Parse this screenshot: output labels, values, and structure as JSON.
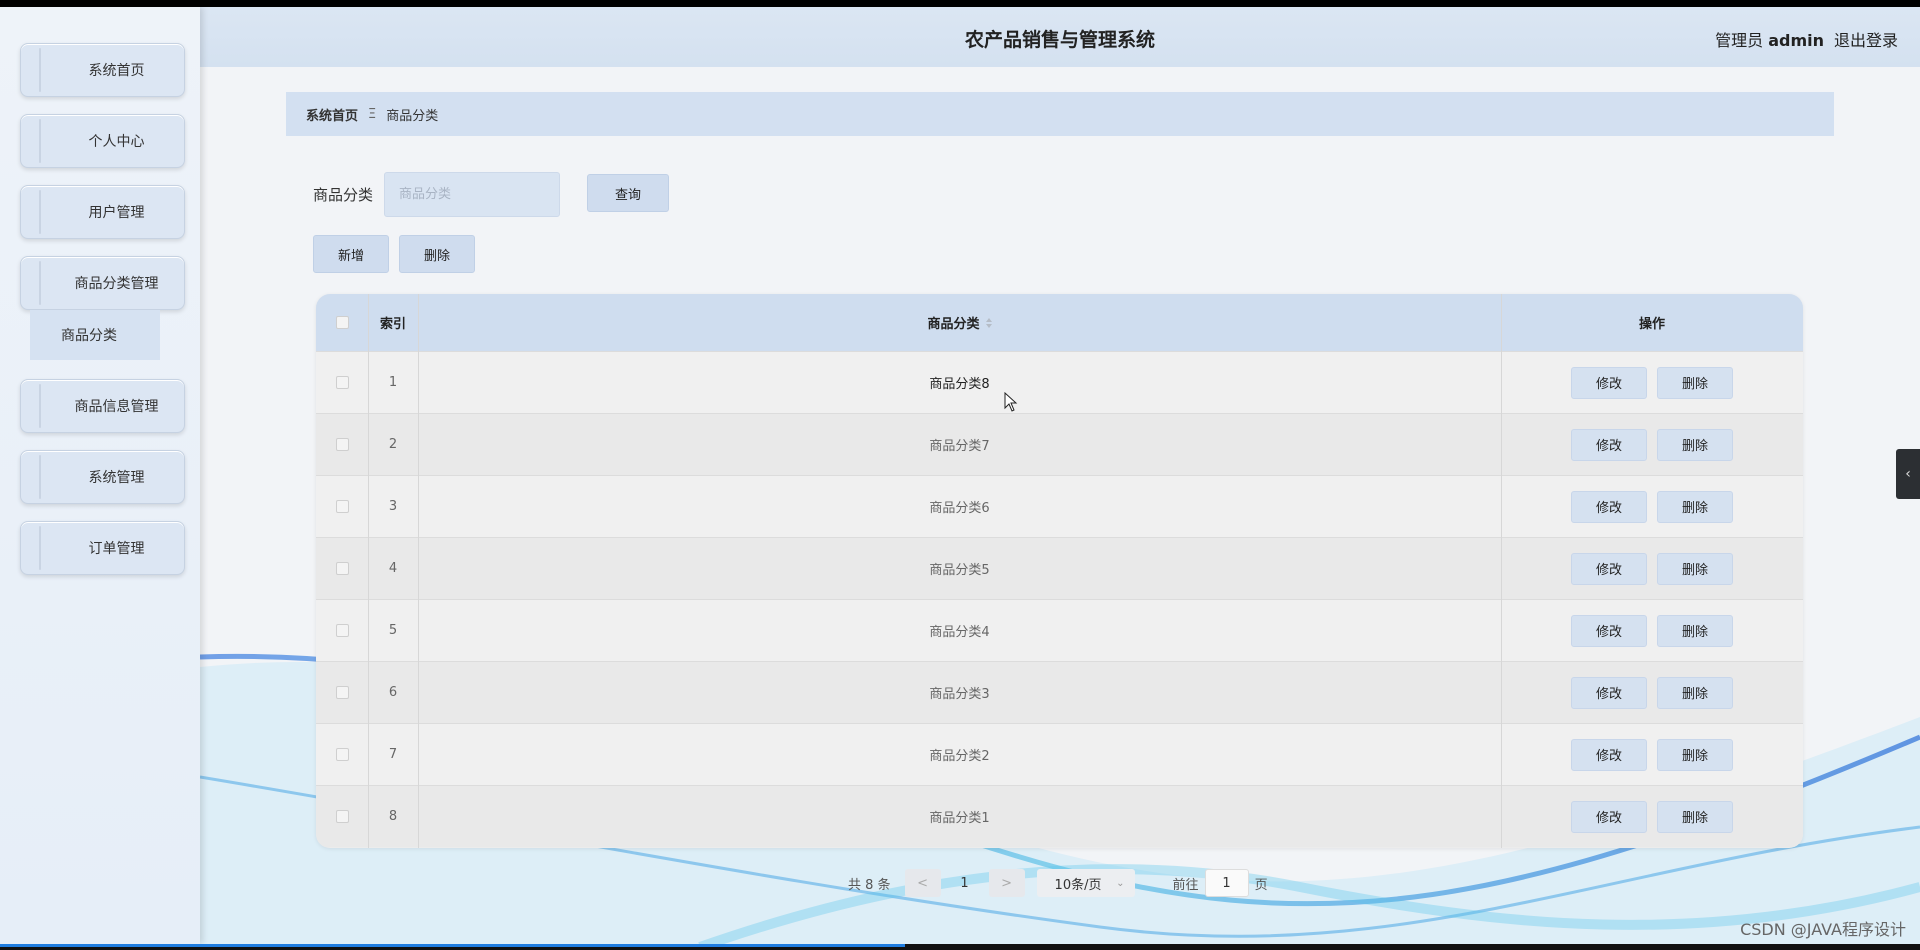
{
  "header": {
    "title": "农产品销售与管理系统",
    "role_label": "管理员",
    "username": "admin",
    "logout_label": "退出登录"
  },
  "sidebar": {
    "items": [
      {
        "label": "系统首页"
      },
      {
        "label": "个人中心"
      },
      {
        "label": "用户管理"
      },
      {
        "label": "商品分类管理"
      },
      {
        "label": "商品信息管理"
      },
      {
        "label": "系统管理"
      },
      {
        "label": "订单管理"
      }
    ],
    "active_submenu": "商品分类"
  },
  "breadcrumb": {
    "home": "系统首页",
    "separator": "Ξ",
    "current": "商品分类"
  },
  "search": {
    "label": "商品分类",
    "placeholder": "商品分类",
    "query_button": "查询"
  },
  "toolbar": {
    "add_label": "新增",
    "delete_label": "删除"
  },
  "table": {
    "headers": {
      "index": "索引",
      "name": "商品分类",
      "actions": "操作"
    },
    "rows": [
      {
        "index": "1",
        "name": "商品分类8"
      },
      {
        "index": "2",
        "name": "商品分类7"
      },
      {
        "index": "3",
        "name": "商品分类6"
      },
      {
        "index": "4",
        "name": "商品分类5"
      },
      {
        "index": "5",
        "name": "商品分类4"
      },
      {
        "index": "6",
        "name": "商品分类3"
      },
      {
        "index": "7",
        "name": "商品分类2"
      },
      {
        "index": "8",
        "name": "商品分类1"
      }
    ],
    "edit_label": "修改",
    "row_delete_label": "删除"
  },
  "pagination": {
    "total_text": "共 8 条",
    "prev": "<",
    "current_page": "1",
    "next": ">",
    "page_size": "10条/页",
    "goto_label": "前往",
    "goto_value": "1",
    "page_unit": "页"
  },
  "watermark": "CSDN @JAVA程序设计",
  "colors": {
    "accent": "#cfdcee",
    "header_bg": "#d4e1f0",
    "progress": "#1f7de0"
  }
}
